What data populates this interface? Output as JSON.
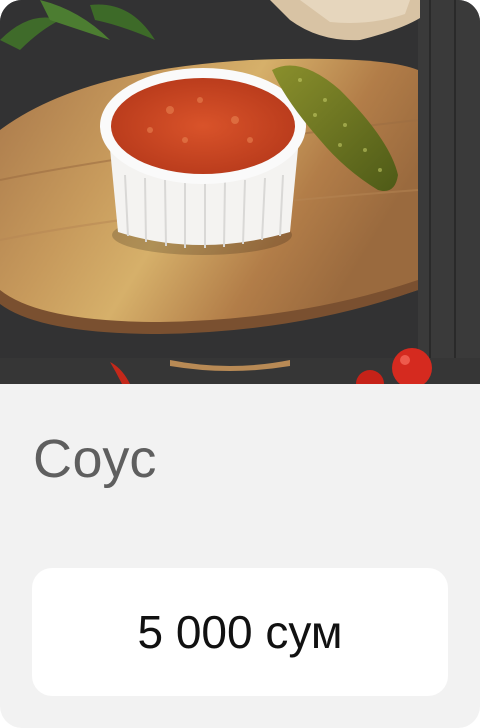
{
  "product": {
    "image_alt_icon": "sauce-dish-photo",
    "title": "Соус",
    "price_label": "5 000 сум"
  },
  "colors": {
    "card_bg": "#f2f2f2",
    "title_text": "#5f5f5f",
    "price_text": "#111111",
    "button_bg": "#ffffff"
  }
}
